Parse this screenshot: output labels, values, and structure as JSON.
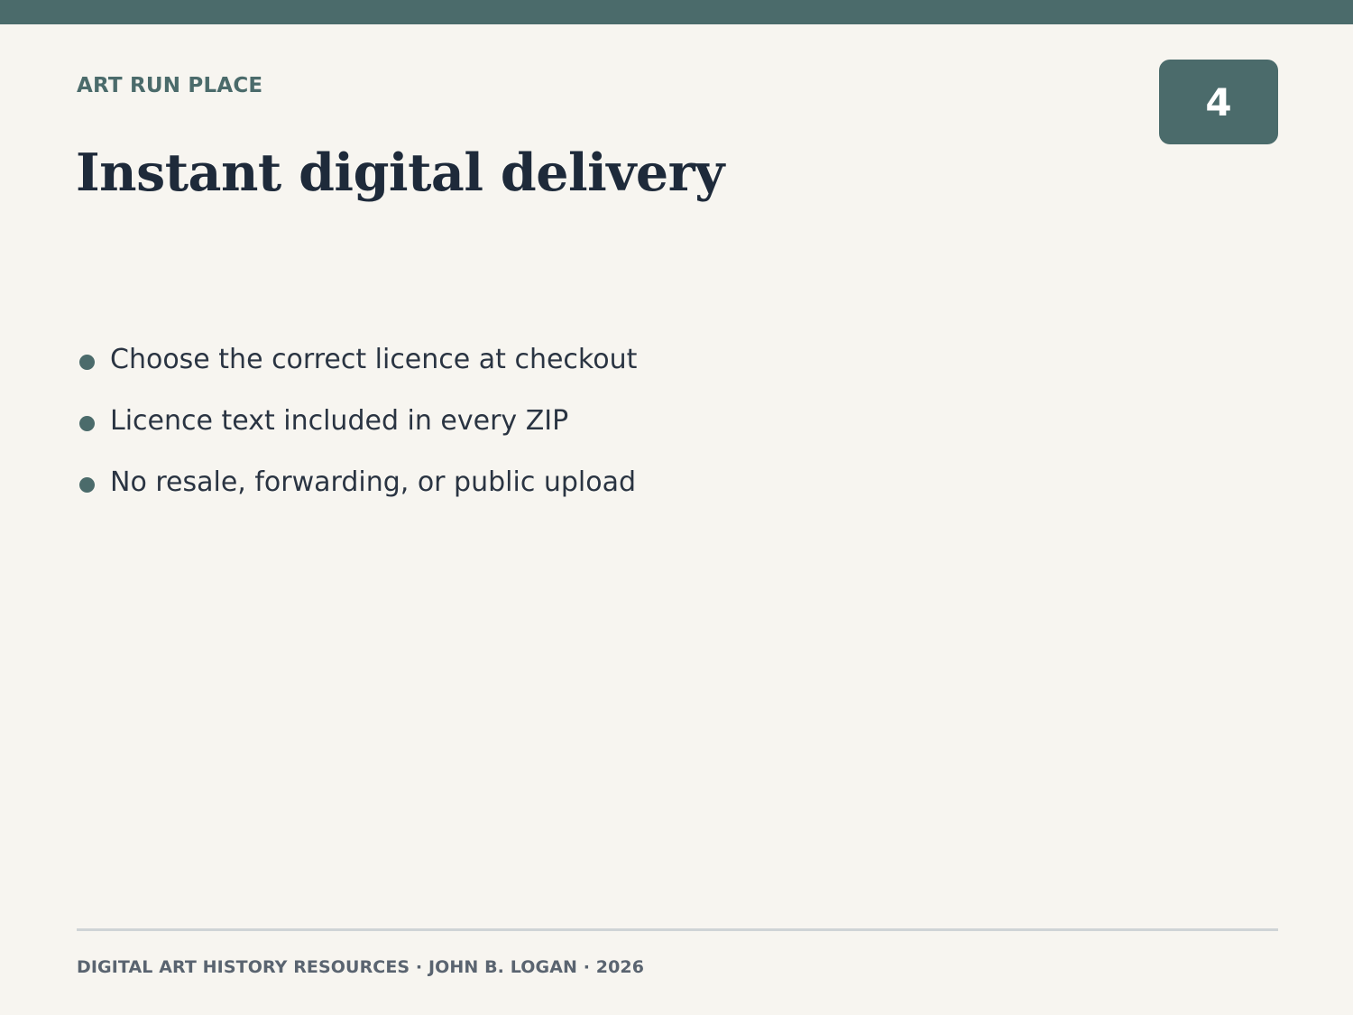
{
  "header": {
    "eyebrow": "ART RUN PLACE",
    "slide_number": "4",
    "title": "Instant digital delivery"
  },
  "bullets": [
    "Choose the correct licence at checkout",
    "Licence text included in every ZIP",
    "No resale, forwarding, or public upload"
  ],
  "footer": {
    "text": "DIGITAL ART HISTORY RESOURCES · JOHN B. LOGAN · 2026"
  },
  "colors": {
    "accent": "#4b6b6b",
    "background": "#f7f5f0",
    "title": "#1e2a3a",
    "body_text": "#2a3442",
    "footer_text": "#5a6470",
    "rule": "#cfd4d6"
  }
}
